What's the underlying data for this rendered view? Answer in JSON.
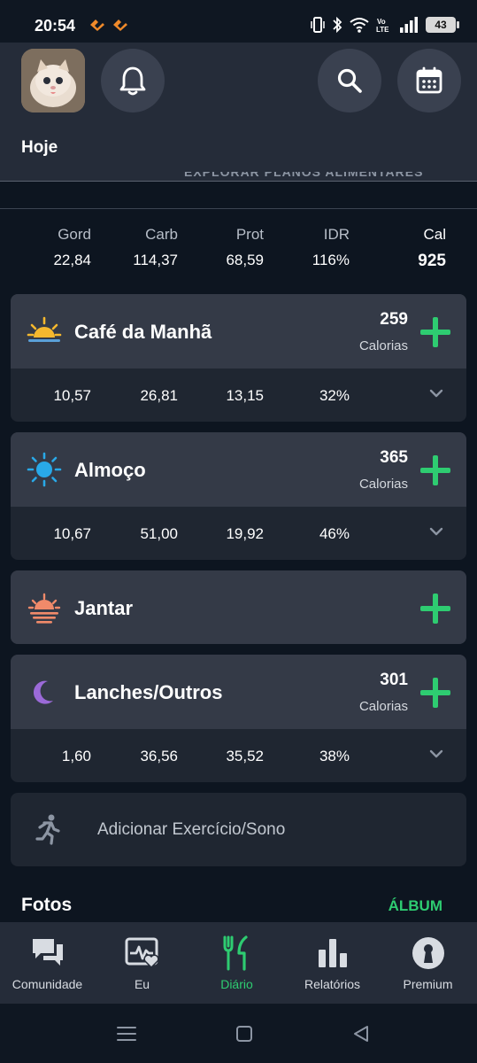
{
  "status_bar": {
    "time": "20:54",
    "battery": "43"
  },
  "header": {
    "title": "Hoje",
    "peek_text": "EXPLORAR PLANOS ALIMENTARES"
  },
  "totals": {
    "labels": {
      "fat": "Gord",
      "carb": "Carb",
      "prot": "Prot",
      "idr": "IDR",
      "cal": "Cal"
    },
    "values": {
      "fat": "22,84",
      "carb": "114,37",
      "prot": "68,59",
      "idr": "116%",
      "cal": "925"
    }
  },
  "meals": [
    {
      "name": "Café da Manhã",
      "calories": "259",
      "calories_label": "Calorias",
      "fat": "10,57",
      "carb": "26,81",
      "prot": "13,15",
      "idr": "32%",
      "icon": "sunrise-icon"
    },
    {
      "name": "Almoço",
      "calories": "365",
      "calories_label": "Calorias",
      "fat": "10,67",
      "carb": "51,00",
      "prot": "19,92",
      "idr": "46%",
      "icon": "sun-icon"
    },
    {
      "name": "Jantar",
      "icon": "sunset-icon"
    },
    {
      "name": "Lanches/Outros",
      "calories": "301",
      "calories_label": "Calorias",
      "fat": "1,60",
      "carb": "36,56",
      "prot": "35,52",
      "idr": "38%",
      "icon": "moon-icon"
    }
  ],
  "exercise": {
    "label": "Adicionar Exercício/Sono",
    "icon": "running-icon"
  },
  "photos": {
    "title": "Fotos",
    "album_link": "ÁLBUM"
  },
  "bottom_nav": [
    {
      "label": "Comunidade",
      "icon": "chat-icon"
    },
    {
      "label": "Eu",
      "icon": "heart-pulse-icon"
    },
    {
      "label": "Diário",
      "icon": "fork-knife-icon",
      "active": true
    },
    {
      "label": "Relatórios",
      "icon": "bar-chart-icon"
    },
    {
      "label": "Premium",
      "icon": "keyhole-icon"
    }
  ],
  "colors": {
    "accent": "#2ecc71",
    "background": "#0d1520",
    "card_header": "#343a47",
    "card_body": "#1f2631",
    "header": "#252c39"
  }
}
